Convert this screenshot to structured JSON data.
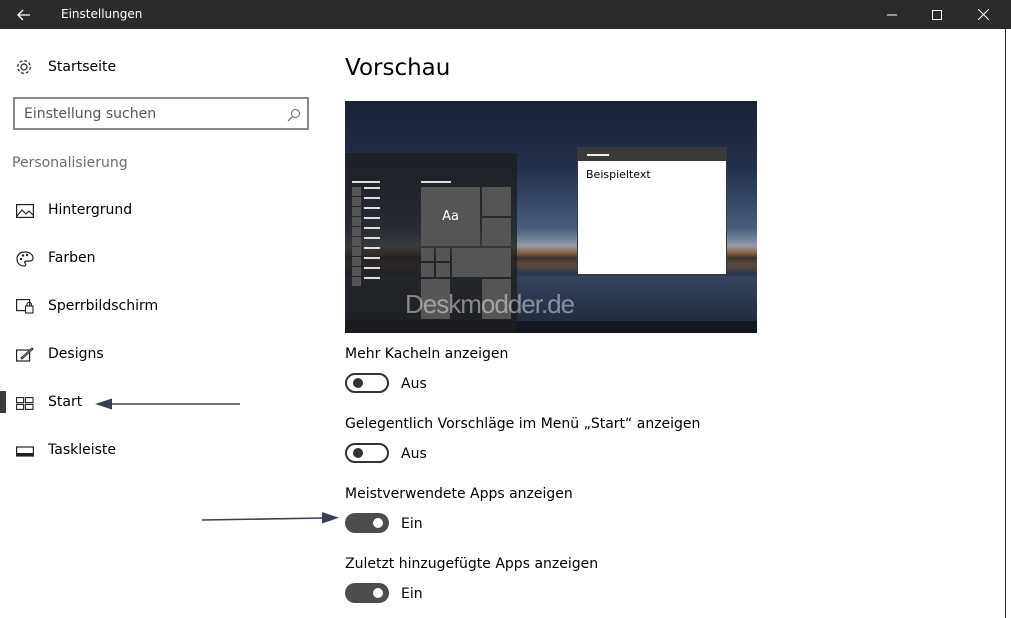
{
  "window": {
    "title": "Einstellungen"
  },
  "sidebar": {
    "home_label": "Startseite",
    "search_placeholder": "Einstellung suchen",
    "category": "Personalisierung",
    "items": [
      {
        "label": "Hintergrund",
        "icon": "picture-icon"
      },
      {
        "label": "Farben",
        "icon": "palette-icon"
      },
      {
        "label": "Sperrbildschirm",
        "icon": "lockscreen-icon"
      },
      {
        "label": "Designs",
        "icon": "themes-icon"
      },
      {
        "label": "Start",
        "icon": "start-icon",
        "selected": true
      },
      {
        "label": "Taskleiste",
        "icon": "taskbar-icon"
      }
    ]
  },
  "main": {
    "title": "Vorschau",
    "preview": {
      "tile_text": "Aa",
      "window_text": "Beispieltext",
      "watermark": "Deskmodder.de"
    },
    "settings": [
      {
        "label": "Mehr Kacheln anzeigen",
        "state": "Aus",
        "on": false
      },
      {
        "label": "Gelegentlich Vorschläge im Menü „Start“ anzeigen",
        "state": "Aus",
        "on": false
      },
      {
        "label": "Meistverwendete Apps anzeigen",
        "state": "Ein",
        "on": true
      },
      {
        "label": "Zuletzt hinzugefügte Apps anzeigen",
        "state": "Ein",
        "on": true
      }
    ]
  },
  "colors": {
    "titlebar": "#2b2b2b",
    "accent_toggle_on": "#4d4d4d"
  }
}
